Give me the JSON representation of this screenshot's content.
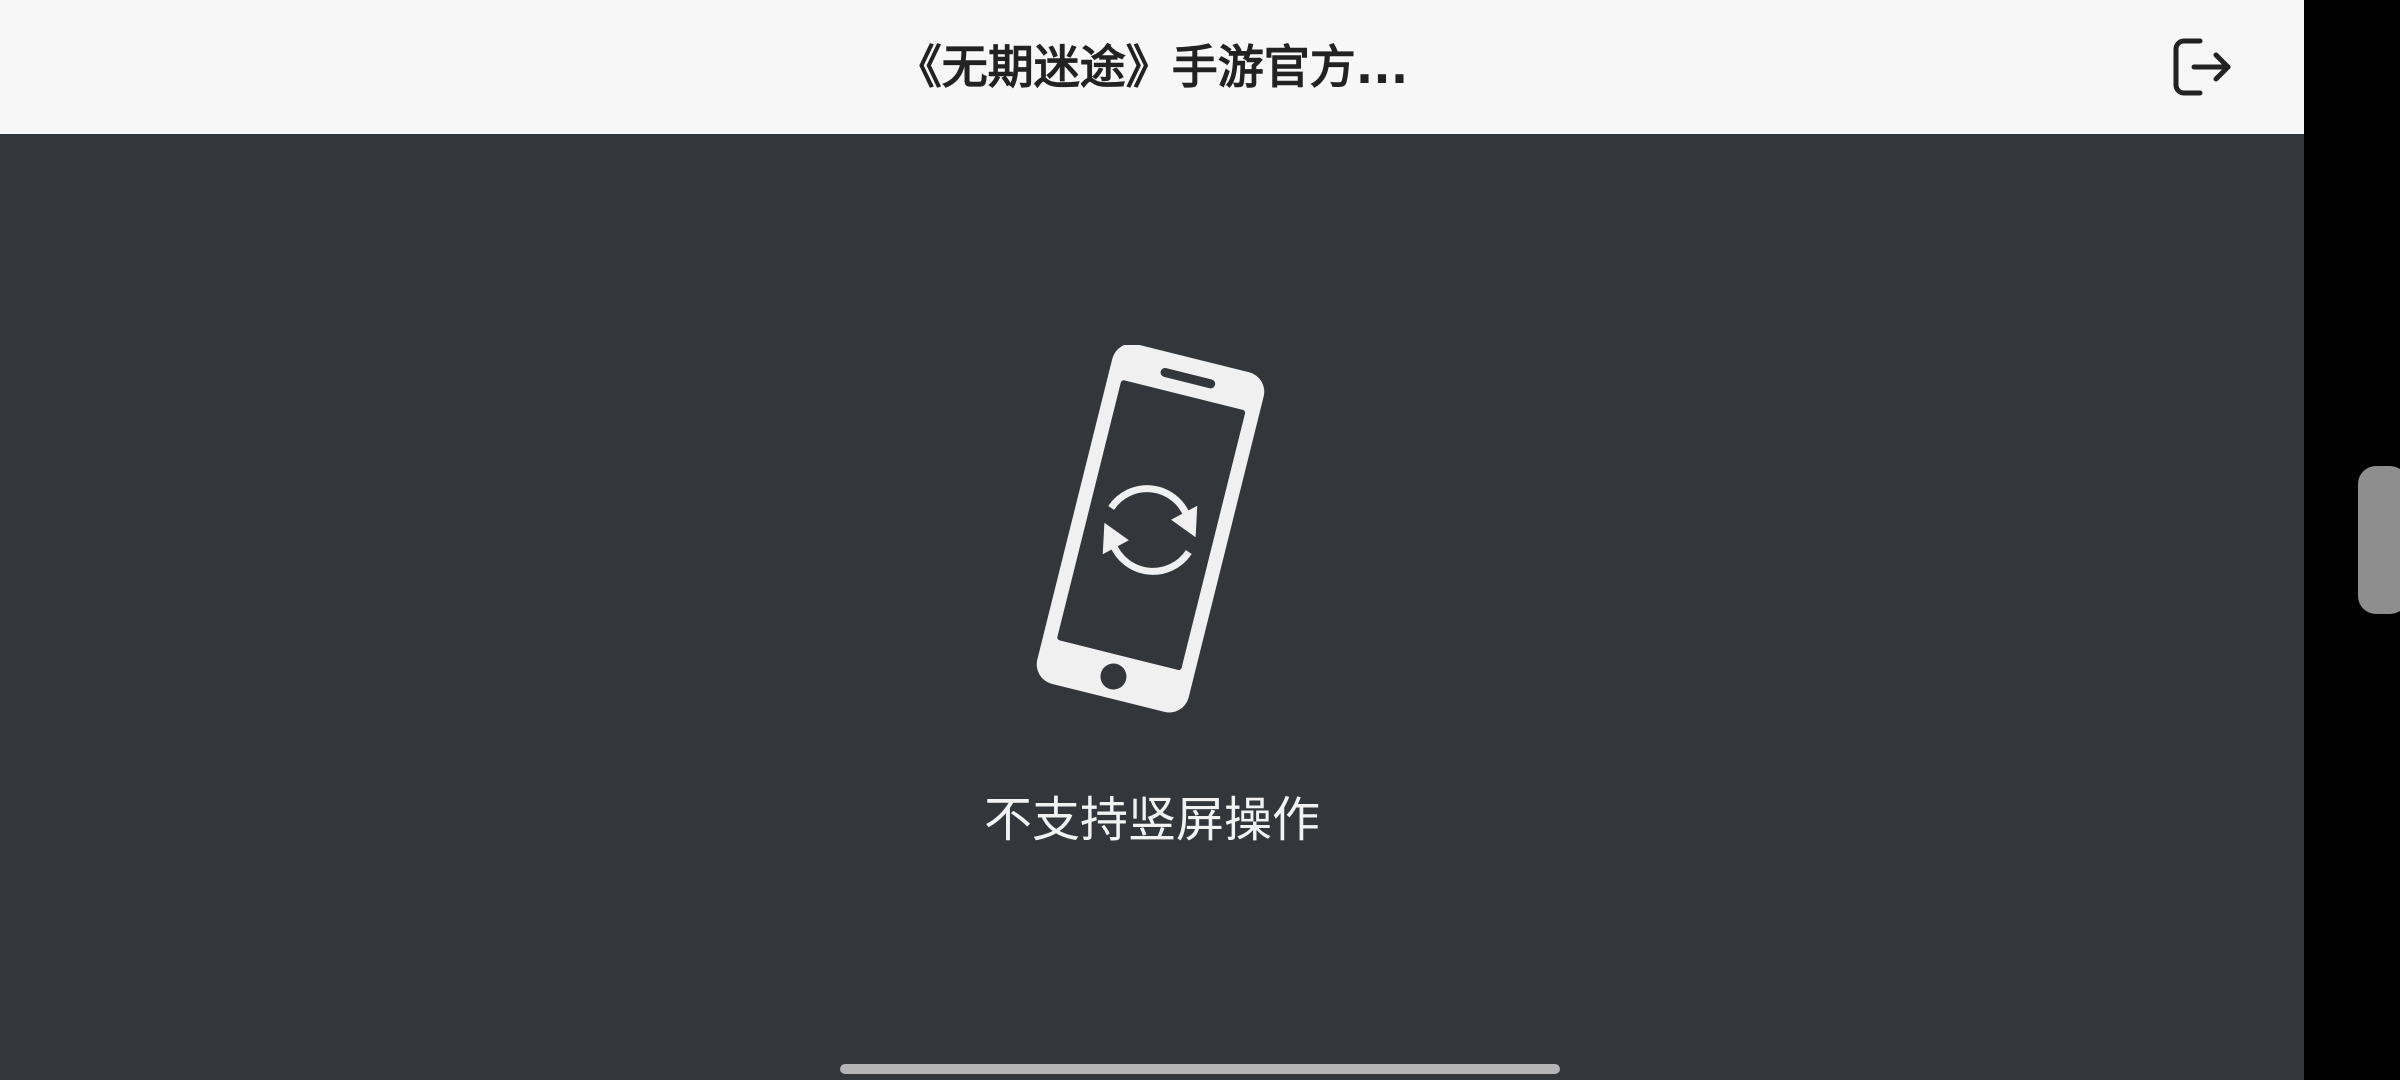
{
  "header": {
    "title": "《无期迷途》手游官方...",
    "exit_icon": "exit-icon"
  },
  "main": {
    "icon": "rotate-phone-icon",
    "message": "不支持竖屏操作"
  },
  "colors": {
    "header_bg": "#f7f7f7",
    "content_bg": "#33373b",
    "title_text": "#222222",
    "message_text": "#f2f2f2",
    "icon_fill": "#f0f0f0"
  }
}
